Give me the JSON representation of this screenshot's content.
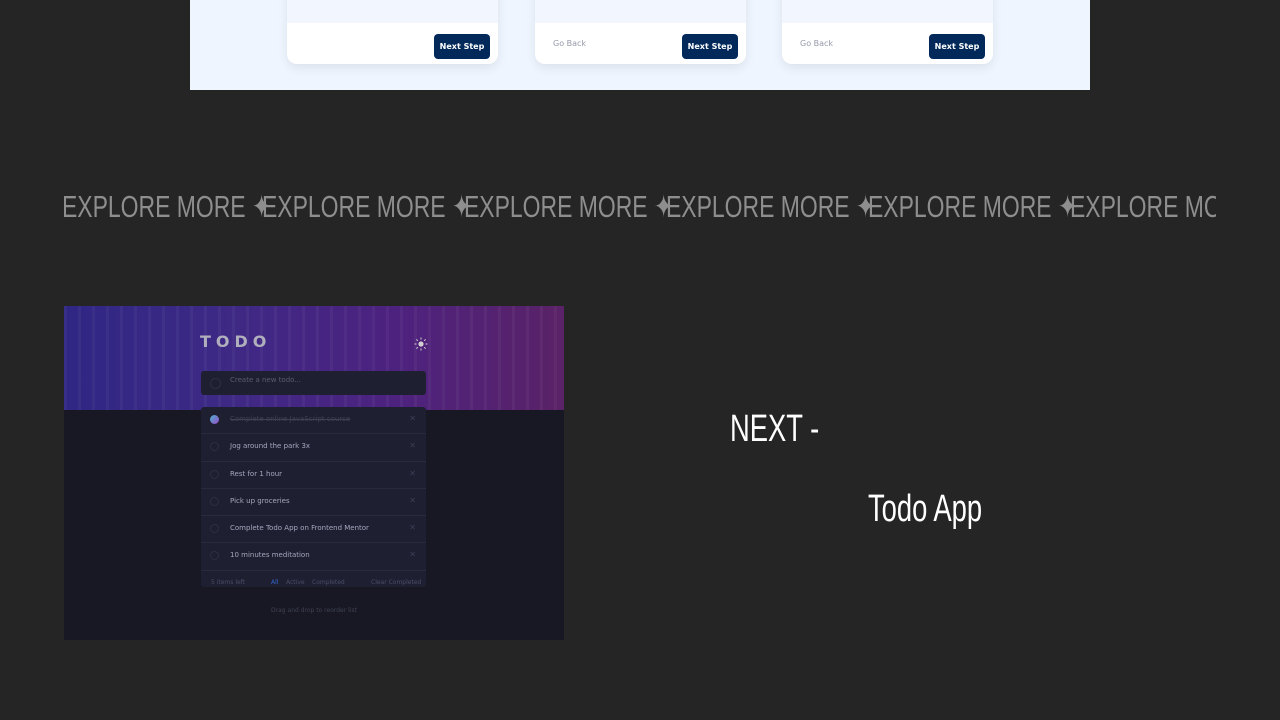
{
  "top_preview": {
    "cards": [
      {
        "back_label": "",
        "next_label": "Next Step"
      },
      {
        "back_label": "Go Back",
        "next_label": "Next Step"
      },
      {
        "back_label": "Go Back",
        "next_label": "Next Step"
      }
    ],
    "accent_color": "#022959"
  },
  "marquee": {
    "text": "EXPLORE MORE",
    "separator": "✦",
    "items": [
      "EXPLORE MORE",
      "EXPLORE MORE",
      "EXPLORE MORE",
      "EXPLORE MORE",
      "EXPLORE MORE",
      "EXPLORE MORE"
    ]
  },
  "thumbnail": {
    "app_title": "TODO",
    "icon": "sun-icon",
    "placeholder": "Create a new todo...",
    "todos": [
      {
        "text": "Complete online JavaScript course",
        "done": true
      },
      {
        "text": "Jog around the park 3x",
        "done": false
      },
      {
        "text": "Rest for 1 hour",
        "done": false
      },
      {
        "text": "Pick up groceries",
        "done": false
      },
      {
        "text": "Complete Todo App on Frontend Mentor",
        "done": false
      },
      {
        "text": "10 minutes meditation",
        "done": false
      }
    ],
    "footer": {
      "items_left": "5 items left",
      "filter_all": "All",
      "filter_active": "Active",
      "filter_completed": "Completed",
      "clear": "Clear Completed"
    },
    "drag_hint": "Drag and drop to reorder list"
  },
  "next_project": {
    "label": "NEXT -",
    "title": "Todo App"
  }
}
